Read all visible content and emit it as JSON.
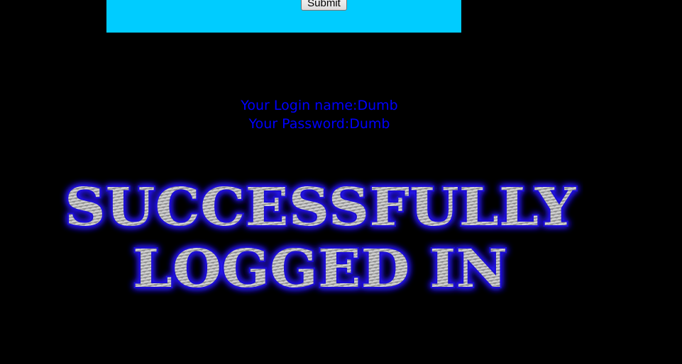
{
  "form": {
    "submit_label": "Submit",
    "panel_color": "#00CCFF"
  },
  "login_info": {
    "name_line": "Your Login name:Dumb",
    "password_line": "Your Password:Dumb",
    "text_color": "#0000FF"
  },
  "banner": {
    "line1": "SUCCESSFULLY",
    "line2": "LOGGED IN",
    "glow_color": "#2A1BFF"
  }
}
